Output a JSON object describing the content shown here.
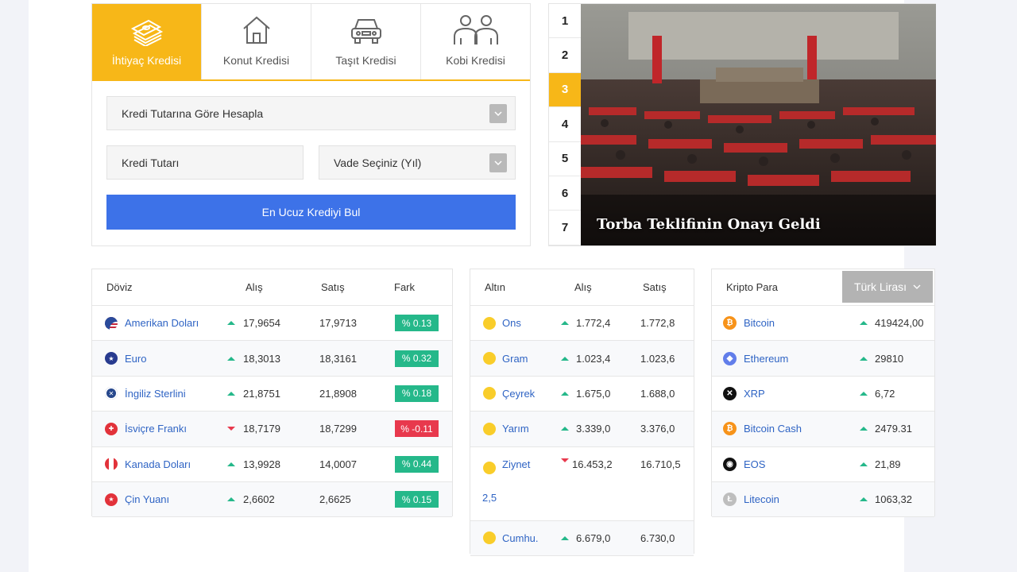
{
  "credit": {
    "tabs": [
      {
        "label": "İhtiyaç Kredisi",
        "icon": "money-stack-icon"
      },
      {
        "label": "Konut Kredisi",
        "icon": "house-icon"
      },
      {
        "label": "Taşıt Kredisi",
        "icon": "car-icon"
      },
      {
        "label": "Kobi Kredisi",
        "icon": "people-icon"
      }
    ],
    "calc_mode": "Kredi Tutarına Göre Hesapla",
    "amount_placeholder": "Kredi Tutarı",
    "term_select": "Vade Seçiniz (Yıl)",
    "find_button": "En Ucuz Krediyi Bul",
    "accent": "#f7b718",
    "button_color": "#3d72e8"
  },
  "news": {
    "numbers": [
      "1",
      "2",
      "3",
      "4",
      "5",
      "6",
      "7"
    ],
    "active": "3",
    "headline": "Torba Teklifinin Onayı Geldi"
  },
  "currency": {
    "headers": {
      "name": "Döviz",
      "buy": "Alış",
      "sell": "Satış",
      "change": "Fark"
    },
    "rows": [
      {
        "name": "Amerikan Doları",
        "buy": "17,9654",
        "sell": "17,9713",
        "change": "% 0.13",
        "dir": "up"
      },
      {
        "name": "Euro",
        "buy": "18,3013",
        "sell": "18,3161",
        "change": "% 0.32",
        "dir": "up"
      },
      {
        "name": "İngiliz Sterlini",
        "buy": "21,8751",
        "sell": "21,8908",
        "change": "% 0.18",
        "dir": "up"
      },
      {
        "name": "İsviçre Frankı",
        "buy": "18,7179",
        "sell": "18,7299",
        "change": "% -0.11",
        "dir": "down"
      },
      {
        "name": "Kanada Doları",
        "buy": "13,9928",
        "sell": "14,0007",
        "change": "% 0.44",
        "dir": "up"
      },
      {
        "name": "Çin Yuanı",
        "buy": "2,6602",
        "sell": "2,6625",
        "change": "% 0.15",
        "dir": "up"
      }
    ]
  },
  "gold": {
    "headers": {
      "name": "Altın",
      "buy": "Alış",
      "sell": "Satış"
    },
    "rows": [
      {
        "name": "Ons",
        "buy": "1.772,4",
        "sell": "1.772,8",
        "dir": "up"
      },
      {
        "name": "Gram",
        "buy": "1.023,4",
        "sell": "1.023,6",
        "dir": "up"
      },
      {
        "name": "Çeyrek",
        "buy": "1.675,0",
        "sell": "1.688,0",
        "dir": "up"
      },
      {
        "name": "Yarım",
        "buy": "3.339,0",
        "sell": "3.376,0",
        "dir": "up"
      },
      {
        "name": "Ziynet",
        "buy": "16.453,2",
        "sell": "16.710,5",
        "extra": "2,5",
        "dir": "down"
      },
      {
        "name": "Cumhu.",
        "buy": "6.679,0",
        "sell": "6.730,0",
        "dir": "up"
      }
    ]
  },
  "crypto": {
    "header": "Kripto Para",
    "currency_select": "Türk Lirası",
    "rows": [
      {
        "name": "Bitcoin",
        "value": "419424,00",
        "icon": "bitcoin-icon",
        "color": "#f7931a"
      },
      {
        "name": "Ethereum",
        "value": "29810",
        "icon": "ethereum-icon",
        "color": "#627eea"
      },
      {
        "name": "XRP",
        "value": "6,72",
        "icon": "xrp-icon",
        "color": "#111111"
      },
      {
        "name": "Bitcoin Cash",
        "value": "2479.31",
        "icon": "bitcoin-cash-icon",
        "color": "#f7931a"
      },
      {
        "name": "EOS",
        "value": "21,89",
        "icon": "eos-icon",
        "color": "#111111"
      },
      {
        "name": "Litecoin",
        "value": "1063,32",
        "icon": "litecoin-icon",
        "color": "#bebebe"
      }
    ]
  }
}
